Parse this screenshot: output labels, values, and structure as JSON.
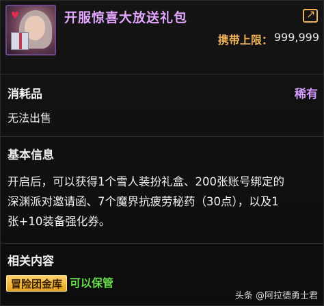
{
  "item": {
    "title": "开服惊喜大放送礼包",
    "carry_limit_label": "携带上限：",
    "carry_limit_value": "999,999",
    "icons": {
      "avatar": "gift-character-icon",
      "share": "share-icon"
    },
    "colors": {
      "title": "#e2a6ff",
      "rarity": "#d79bff",
      "accent": "#f0b35a",
      "storable": "#68e04a"
    }
  },
  "consumable": {
    "heading": "消耗品",
    "rarity": "稀有",
    "sell_status": "无法出售"
  },
  "basic_info": {
    "heading": "基本信息",
    "line1": "开启后，可以获得1个雪人装扮礼盒、200张账号绑定的",
    "line2": "深渊派对邀请函、7个魔界抗疲劳秘药（30点），以及1",
    "line3": "张+10装备强化券。"
  },
  "related": {
    "heading": "相关内容",
    "tag": "冒险团金库",
    "storable": "可以保管"
  },
  "watermark": "头条 @阿拉德勇士君"
}
